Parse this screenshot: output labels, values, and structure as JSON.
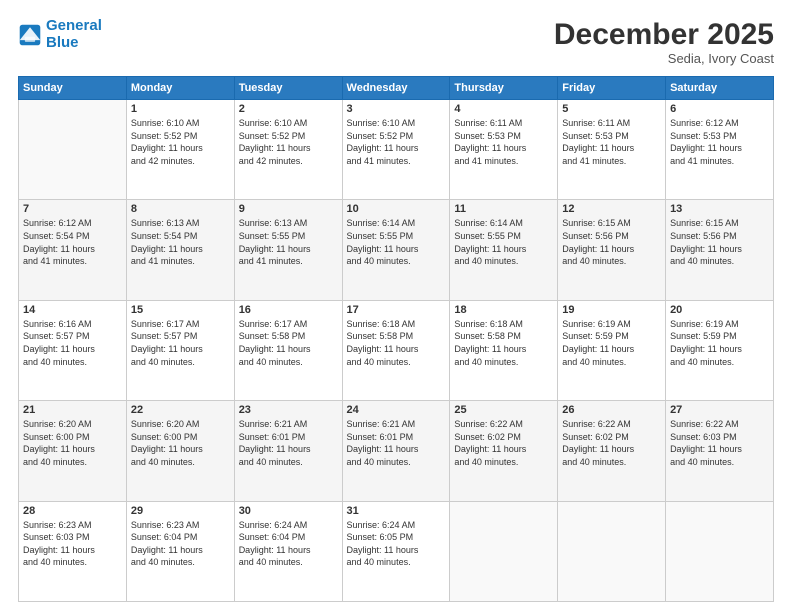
{
  "header": {
    "logo_line1": "General",
    "logo_line2": "Blue",
    "month": "December 2025",
    "location": "Sedia, Ivory Coast"
  },
  "weekdays": [
    "Sunday",
    "Monday",
    "Tuesday",
    "Wednesday",
    "Thursday",
    "Friday",
    "Saturday"
  ],
  "weeks": [
    [
      {
        "day": "",
        "info": ""
      },
      {
        "day": "1",
        "info": "Sunrise: 6:10 AM\nSunset: 5:52 PM\nDaylight: 11 hours\nand 42 minutes."
      },
      {
        "day": "2",
        "info": "Sunrise: 6:10 AM\nSunset: 5:52 PM\nDaylight: 11 hours\nand 42 minutes."
      },
      {
        "day": "3",
        "info": "Sunrise: 6:10 AM\nSunset: 5:52 PM\nDaylight: 11 hours\nand 41 minutes."
      },
      {
        "day": "4",
        "info": "Sunrise: 6:11 AM\nSunset: 5:53 PM\nDaylight: 11 hours\nand 41 minutes."
      },
      {
        "day": "5",
        "info": "Sunrise: 6:11 AM\nSunset: 5:53 PM\nDaylight: 11 hours\nand 41 minutes."
      },
      {
        "day": "6",
        "info": "Sunrise: 6:12 AM\nSunset: 5:53 PM\nDaylight: 11 hours\nand 41 minutes."
      }
    ],
    [
      {
        "day": "7",
        "info": "Sunrise: 6:12 AM\nSunset: 5:54 PM\nDaylight: 11 hours\nand 41 minutes."
      },
      {
        "day": "8",
        "info": "Sunrise: 6:13 AM\nSunset: 5:54 PM\nDaylight: 11 hours\nand 41 minutes."
      },
      {
        "day": "9",
        "info": "Sunrise: 6:13 AM\nSunset: 5:55 PM\nDaylight: 11 hours\nand 41 minutes."
      },
      {
        "day": "10",
        "info": "Sunrise: 6:14 AM\nSunset: 5:55 PM\nDaylight: 11 hours\nand 40 minutes."
      },
      {
        "day": "11",
        "info": "Sunrise: 6:14 AM\nSunset: 5:55 PM\nDaylight: 11 hours\nand 40 minutes."
      },
      {
        "day": "12",
        "info": "Sunrise: 6:15 AM\nSunset: 5:56 PM\nDaylight: 11 hours\nand 40 minutes."
      },
      {
        "day": "13",
        "info": "Sunrise: 6:15 AM\nSunset: 5:56 PM\nDaylight: 11 hours\nand 40 minutes."
      }
    ],
    [
      {
        "day": "14",
        "info": "Sunrise: 6:16 AM\nSunset: 5:57 PM\nDaylight: 11 hours\nand 40 minutes."
      },
      {
        "day": "15",
        "info": "Sunrise: 6:17 AM\nSunset: 5:57 PM\nDaylight: 11 hours\nand 40 minutes."
      },
      {
        "day": "16",
        "info": "Sunrise: 6:17 AM\nSunset: 5:58 PM\nDaylight: 11 hours\nand 40 minutes."
      },
      {
        "day": "17",
        "info": "Sunrise: 6:18 AM\nSunset: 5:58 PM\nDaylight: 11 hours\nand 40 minutes."
      },
      {
        "day": "18",
        "info": "Sunrise: 6:18 AM\nSunset: 5:58 PM\nDaylight: 11 hours\nand 40 minutes."
      },
      {
        "day": "19",
        "info": "Sunrise: 6:19 AM\nSunset: 5:59 PM\nDaylight: 11 hours\nand 40 minutes."
      },
      {
        "day": "20",
        "info": "Sunrise: 6:19 AM\nSunset: 5:59 PM\nDaylight: 11 hours\nand 40 minutes."
      }
    ],
    [
      {
        "day": "21",
        "info": "Sunrise: 6:20 AM\nSunset: 6:00 PM\nDaylight: 11 hours\nand 40 minutes."
      },
      {
        "day": "22",
        "info": "Sunrise: 6:20 AM\nSunset: 6:00 PM\nDaylight: 11 hours\nand 40 minutes."
      },
      {
        "day": "23",
        "info": "Sunrise: 6:21 AM\nSunset: 6:01 PM\nDaylight: 11 hours\nand 40 minutes."
      },
      {
        "day": "24",
        "info": "Sunrise: 6:21 AM\nSunset: 6:01 PM\nDaylight: 11 hours\nand 40 minutes."
      },
      {
        "day": "25",
        "info": "Sunrise: 6:22 AM\nSunset: 6:02 PM\nDaylight: 11 hours\nand 40 minutes."
      },
      {
        "day": "26",
        "info": "Sunrise: 6:22 AM\nSunset: 6:02 PM\nDaylight: 11 hours\nand 40 minutes."
      },
      {
        "day": "27",
        "info": "Sunrise: 6:22 AM\nSunset: 6:03 PM\nDaylight: 11 hours\nand 40 minutes."
      }
    ],
    [
      {
        "day": "28",
        "info": "Sunrise: 6:23 AM\nSunset: 6:03 PM\nDaylight: 11 hours\nand 40 minutes."
      },
      {
        "day": "29",
        "info": "Sunrise: 6:23 AM\nSunset: 6:04 PM\nDaylight: 11 hours\nand 40 minutes."
      },
      {
        "day": "30",
        "info": "Sunrise: 6:24 AM\nSunset: 6:04 PM\nDaylight: 11 hours\nand 40 minutes."
      },
      {
        "day": "31",
        "info": "Sunrise: 6:24 AM\nSunset: 6:05 PM\nDaylight: 11 hours\nand 40 minutes."
      },
      {
        "day": "",
        "info": ""
      },
      {
        "day": "",
        "info": ""
      },
      {
        "day": "",
        "info": ""
      }
    ]
  ]
}
